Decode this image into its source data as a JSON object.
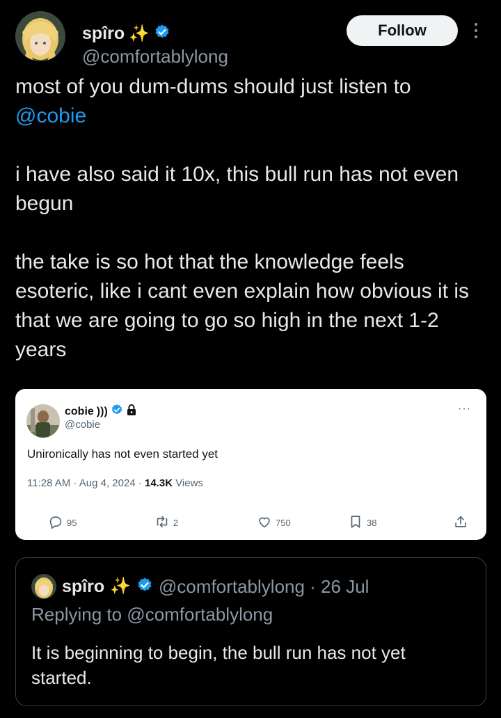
{
  "author": {
    "name": "spîro",
    "emoji": "✨",
    "handle": "@comfortablylong"
  },
  "header": {
    "follow_label": "Follow"
  },
  "tweet": {
    "line1_text": "most of you dum-dums should just listen to",
    "line1_mention": "@cobie",
    "paragraph2": "i have also said it 10x, this bull run has not even begun",
    "paragraph3": "the take is so hot that the knowledge feels esoteric, like i cant even explain how obvious it is that we are going to go so high in the next 1-2 years"
  },
  "embedded": {
    "name": "cobie",
    "name_suffix": ")))",
    "handle": "@cobie",
    "text": "Unironically has not even started yet",
    "time": "11:28 AM · Aug 4, 2024 · ",
    "views_count": "14.3K",
    "views_label": " Views",
    "more": "···",
    "replies": "95",
    "retweets": "2",
    "likes": "750",
    "bookmarks": "38"
  },
  "quoted": {
    "name": "spîro",
    "emoji": "✨",
    "handle_date": "@comfortablylong · 26 Jul",
    "replying": "Replying to @comfortablylong",
    "text": "It is beginning to begin, the bull run has not yet started."
  },
  "colors": {
    "background": "#000000",
    "text": "#e7e9ea",
    "secondary": "#8b98a5",
    "accent": "#1d9bf0",
    "card_bg": "#ffffff"
  },
  "icons": [
    "verified-badge-icon",
    "more-options-icon",
    "lock-icon",
    "reply-icon",
    "retweet-icon",
    "like-icon",
    "bookmark-icon",
    "share-icon"
  ]
}
